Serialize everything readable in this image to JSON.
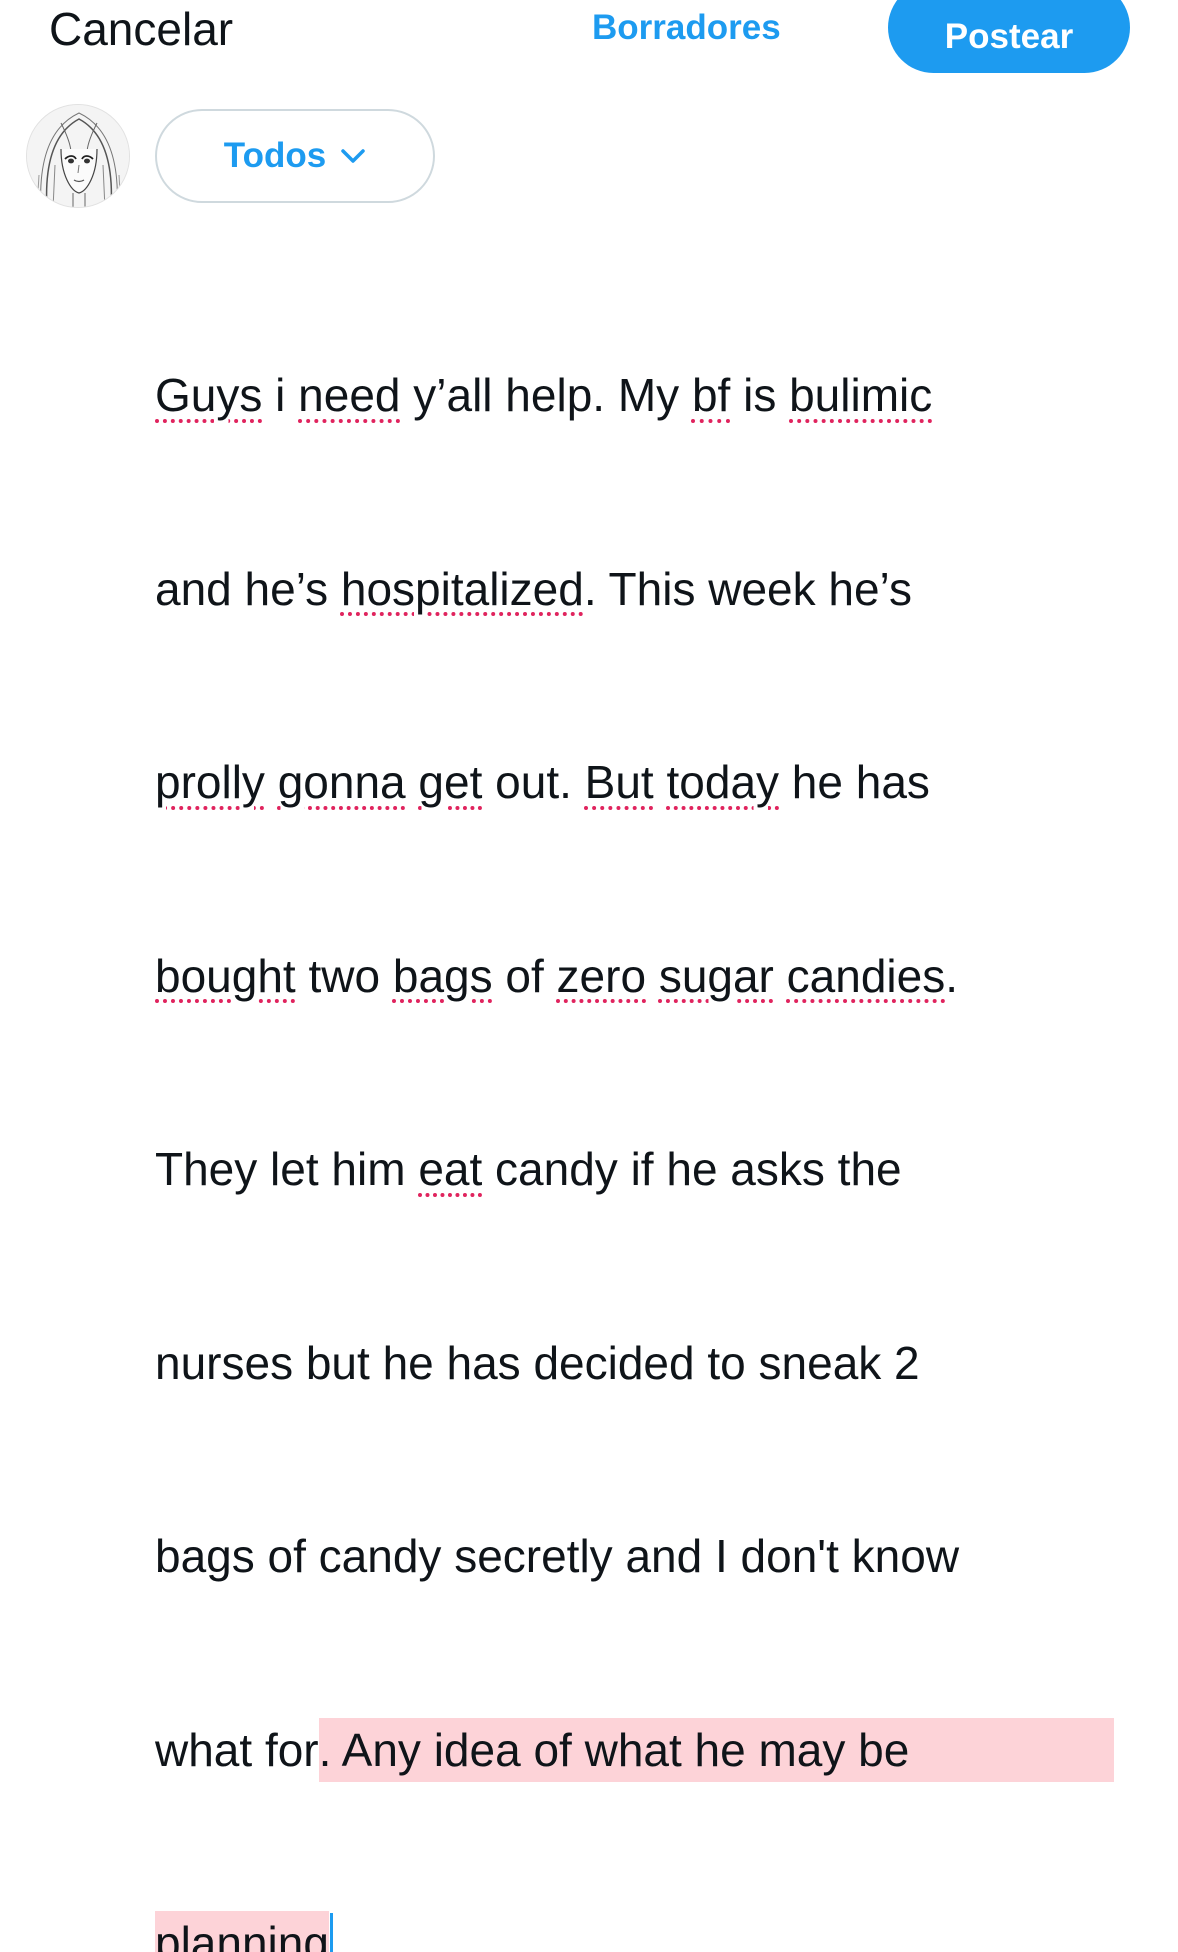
{
  "header": {
    "cancel_label": "Cancelar",
    "drafts_label": "Borradores",
    "post_label": "Postear"
  },
  "audience": {
    "label": "Todos"
  },
  "composer": {
    "line1": {
      "p1": "Guys",
      "p2": " i ",
      "p3": "need",
      "p4": " y’all help. My ",
      "p5": "bf",
      "p6": " is ",
      "p7": "bulimic"
    },
    "line2": {
      "p1": "and he’s ",
      "p2": "hospitalized",
      "p3": ". This week he’s"
    },
    "line3": {
      "p1": "prolly",
      "p2": " ",
      "p3": "gonna",
      "p4": " ",
      "p5": "get",
      "p6": " out. ",
      "p7": "But",
      "p8": " ",
      "p9": "today",
      "p10": " he has"
    },
    "line4": {
      "p1": "bought",
      "p2": " two ",
      "p3": "bags",
      "p4": " of ",
      "p5": "zero",
      "p6": " ",
      "p7": "sugar",
      "p8": " ",
      "p9": "candies",
      "p10": "."
    },
    "line5": {
      "p1": "They let him ",
      "p2": "eat",
      "p3": " candy if he asks the"
    },
    "line6": "nurses but he has decided to sneak 2",
    "line7": "bags of candy secretly and I don't know",
    "line8": {
      "p1": "what for",
      "p2": ". Any idea of what he may be"
    },
    "line9": "planning",
    "spell_color": "#e0245e",
    "highlight_color": "#fdd3d8",
    "caret_color": "#1d9bf0"
  },
  "colors": {
    "accent": "#1d9bf0",
    "text": "#0f1419",
    "border": "#cfd9de"
  },
  "icons": {
    "audience_chevron": "chevron-down-icon",
    "avatar": "manga-avatar"
  }
}
